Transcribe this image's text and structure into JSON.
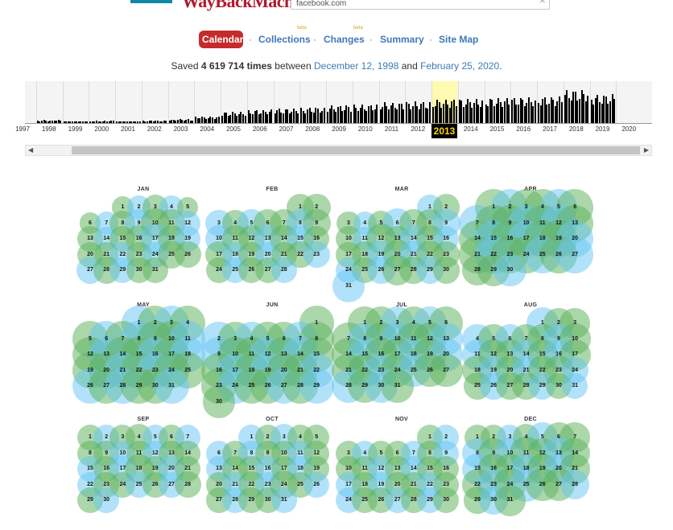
{
  "header": {
    "logo_text": "WayBackMachine",
    "url_value": "facebook.com",
    "clear_icon": "close-icon"
  },
  "nav": {
    "items": [
      {
        "label": "Calendar",
        "active": true,
        "beta": ""
      },
      {
        "label": "Collections",
        "active": false,
        "beta": "beta"
      },
      {
        "label": "Changes",
        "active": false,
        "beta": "beta"
      },
      {
        "label": "Summary",
        "active": false,
        "beta": ""
      },
      {
        "label": "Site Map",
        "active": false,
        "beta": ""
      }
    ],
    "separator": "·"
  },
  "saved": {
    "prefix": "Saved ",
    "count": "4 619 714 times",
    "between": " between ",
    "from": "December 12, 1998",
    "and": " and ",
    "to": "February 25, 2020",
    "suffix": "."
  },
  "timeline": {
    "years": [
      "1997",
      "1998",
      "1999",
      "2000",
      "2001",
      "2002",
      "2003",
      "2004",
      "2005",
      "2006",
      "2007",
      "2008",
      "2009",
      "2010",
      "2011",
      "2012",
      "2013",
      "2014",
      "2015",
      "2016",
      "2017",
      "2018",
      "2019",
      "2020"
    ],
    "selected_year": "2013",
    "yearly_capture_level": [
      0,
      0.08,
      0.05,
      0.06,
      0.05,
      0.07,
      0.1,
      0.18,
      0.3,
      0.36,
      0.4,
      0.42,
      0.48,
      0.5,
      0.56,
      0.58,
      0.64,
      0.66,
      0.68,
      0.7,
      0.72,
      0.9,
      0.78,
      0
    ]
  },
  "calendar": {
    "months": [
      {
        "name": "JAN",
        "start": 2,
        "days": 31
      },
      {
        "name": "FEB",
        "start": 5,
        "days": 28
      },
      {
        "name": "MAR",
        "start": 5,
        "days": 31
      },
      {
        "name": "APR",
        "start": 1,
        "days": 30
      },
      {
        "name": "MAY",
        "start": 3,
        "days": 31
      },
      {
        "name": "JUN",
        "start": 6,
        "days": 30
      },
      {
        "name": "JUL",
        "start": 1,
        "days": 31
      },
      {
        "name": "AUG",
        "start": 4,
        "days": 31
      },
      {
        "name": "SEP",
        "start": 0,
        "days": 30
      },
      {
        "name": "OCT",
        "start": 2,
        "days": 31
      },
      {
        "name": "NOV",
        "start": 5,
        "days": 30
      },
      {
        "name": "DEC",
        "start": 0,
        "days": 31
      }
    ],
    "capture_level": {
      "JAN": [
        0.35,
        0.4,
        0.5,
        0.45,
        0.3,
        0.3,
        0.4,
        0.5,
        0.6,
        0.65,
        0.6,
        0.5,
        0.5,
        0.45,
        0.5,
        0.55,
        0.7,
        0.6,
        0.5,
        0.5,
        0.45,
        0.5,
        0.5,
        0.5,
        0.6,
        0.55,
        0.6,
        0.55,
        0.5,
        0.5,
        0.5
      ],
      "FEB": [
        0.6,
        0.6,
        0.55,
        0.55,
        0.6,
        0.6,
        0.6,
        0.6,
        0.6,
        0.55,
        0.55,
        0.55,
        0.55,
        0.6,
        0.6,
        0.5,
        0.55,
        0.5,
        0.5,
        0.5,
        0.5,
        0.55,
        0.55,
        0.5,
        0.5,
        0.5,
        0.5,
        0.5
      ],
      "MAR": [
        0.5,
        0.55,
        0.4,
        0.4,
        0.5,
        0.7,
        0.6,
        0.6,
        0.6,
        0.5,
        0.45,
        0.7,
        0.5,
        0.55,
        0.55,
        0.5,
        0.5,
        0.55,
        0.6,
        0.65,
        0.6,
        0.6,
        0.55,
        0.5,
        0.5,
        0.6,
        0.7,
        0.6,
        0.6,
        0.55,
        0.8
      ],
      "APR": [
        1.0,
        1.0,
        1.0,
        1.0,
        1.0,
        1.0,
        1.0,
        1.0,
        1.0,
        1.0,
        1.0,
        1.0,
        1.0,
        1.0,
        1.0,
        1.0,
        1.0,
        1.0,
        1.0,
        1.0,
        1.0,
        1.0,
        1.0,
        1.0,
        1.0,
        1.0,
        1.0,
        0.7,
        0.8,
        0.8
      ],
      "MAY": [
        0.9,
        0.9,
        0.9,
        0.95,
        0.95,
        0.95,
        0.95,
        0.95,
        0.95,
        0.95,
        0.95,
        0.95,
        0.95,
        0.95,
        0.95,
        0.95,
        0.95,
        0.95,
        0.95,
        0.95,
        0.95,
        0.95,
        0.95,
        0.95,
        0.95,
        0.95,
        0.95,
        0.95,
        0.95,
        0.95,
        0.9
      ],
      "JUN": [
        0.9,
        0.9,
        0.9,
        0.9,
        0.9,
        0.9,
        0.9,
        0.9,
        0.9,
        0.9,
        0.9,
        0.9,
        0.9,
        0.9,
        0.9,
        0.9,
        0.9,
        0.9,
        0.9,
        0.9,
        0.9,
        0.9,
        0.9,
        0.9,
        0.9,
        0.9,
        0.9,
        0.9,
        0.9,
        0.8
      ],
      "JUL": [
        0.85,
        0.85,
        0.85,
        0.85,
        0.85,
        0.85,
        0.85,
        0.85,
        0.85,
        0.85,
        0.85,
        0.85,
        0.85,
        0.85,
        0.85,
        0.85,
        0.85,
        0.85,
        0.85,
        0.85,
        0.85,
        0.85,
        0.85,
        0.85,
        0.85,
        0.85,
        0.85,
        0.85,
        0.85,
        0.85,
        0.85
      ],
      "AUG": [
        0.8,
        0.7,
        0.7,
        0.7,
        0.7,
        0.7,
        0.7,
        0.7,
        0.7,
        0.75,
        0.75,
        0.7,
        0.7,
        0.7,
        0.7,
        0.75,
        0.75,
        0.7,
        0.7,
        0.7,
        0.65,
        0.65,
        0.7,
        0.55,
        0.6,
        0.6,
        0.6,
        0.6,
        0.55,
        0.5,
        0.5
      ],
      "SEP": [
        0.5,
        0.5,
        0.5,
        0.55,
        0.5,
        0.5,
        0.5,
        0.5,
        0.5,
        0.5,
        0.5,
        0.5,
        0.5,
        0.5,
        0.5,
        0.5,
        0.6,
        0.65,
        0.5,
        0.6,
        0.5,
        0.5,
        0.5,
        0.5,
        0.55,
        0.5,
        0.5,
        0.55,
        0.5,
        0.5
      ],
      "OCT": [
        0.5,
        0.5,
        0.55,
        0.5,
        0.5,
        0.5,
        0.5,
        0.5,
        0.5,
        0.5,
        0.5,
        0.5,
        0.5,
        0.5,
        0.5,
        0.5,
        0.5,
        0.5,
        0.5,
        0.5,
        0.5,
        0.55,
        0.5,
        0.6,
        0.5,
        0.5,
        0.5,
        0.5,
        0.5,
        0.5,
        0.5
      ],
      "NOV": [
        0.5,
        0.5,
        0.5,
        0.5,
        0.5,
        0.5,
        0.5,
        0.5,
        0.5,
        0.5,
        0.5,
        0.5,
        0.5,
        0.5,
        0.5,
        0.5,
        0.5,
        0.5,
        0.5,
        0.5,
        0.5,
        0.5,
        0.5,
        0.5,
        0.5,
        0.5,
        0.5,
        0.5,
        0.5,
        0.5
      ],
      "DEC": [
        0.5,
        0.5,
        0.5,
        0.55,
        0.7,
        0.75,
        0.7,
        0.7,
        0.7,
        0.75,
        0.8,
        0.7,
        0.8,
        0.7,
        0.75,
        0.7,
        0.75,
        0.7,
        0.7,
        0.7,
        0.7,
        0.75,
        0.8,
        0.8,
        0.9,
        0.85,
        0.8,
        0.65,
        0.55,
        0.65,
        0.75
      ]
    }
  }
}
